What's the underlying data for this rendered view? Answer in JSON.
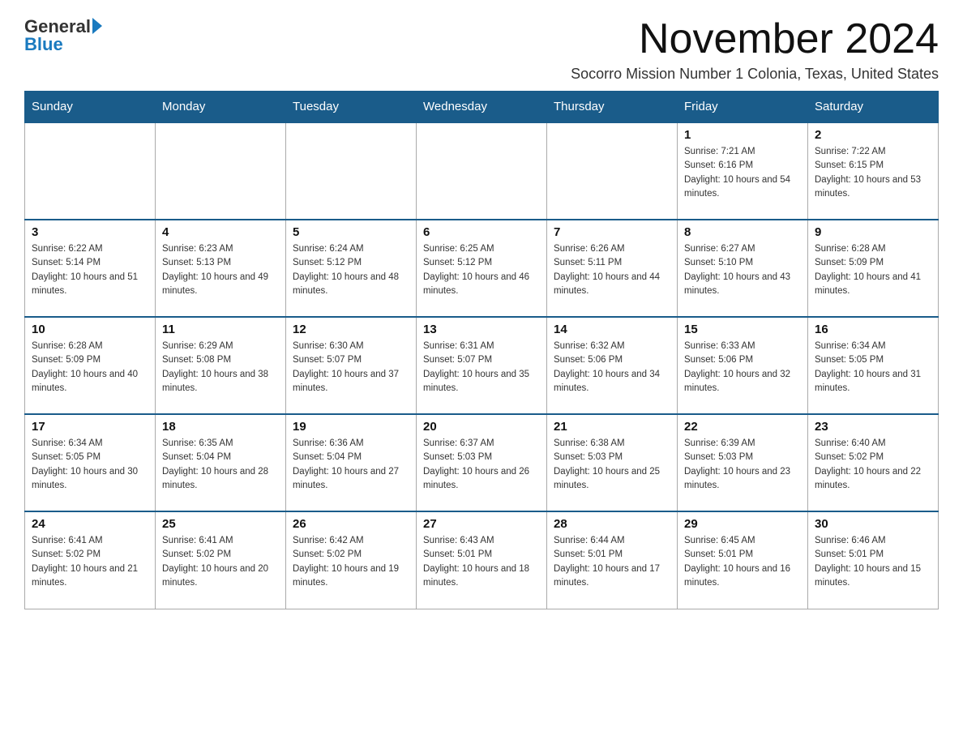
{
  "header": {
    "logo_general": "General",
    "logo_blue": "Blue",
    "month_title": "November 2024",
    "subtitle": "Socorro Mission Number 1 Colonia, Texas, United States"
  },
  "calendar": {
    "days_of_week": [
      "Sunday",
      "Monday",
      "Tuesday",
      "Wednesday",
      "Thursday",
      "Friday",
      "Saturday"
    ],
    "weeks": [
      [
        {
          "day": "",
          "info": ""
        },
        {
          "day": "",
          "info": ""
        },
        {
          "day": "",
          "info": ""
        },
        {
          "day": "",
          "info": ""
        },
        {
          "day": "",
          "info": ""
        },
        {
          "day": "1",
          "info": "Sunrise: 7:21 AM\nSunset: 6:16 PM\nDaylight: 10 hours and 54 minutes."
        },
        {
          "day": "2",
          "info": "Sunrise: 7:22 AM\nSunset: 6:15 PM\nDaylight: 10 hours and 53 minutes."
        }
      ],
      [
        {
          "day": "3",
          "info": "Sunrise: 6:22 AM\nSunset: 5:14 PM\nDaylight: 10 hours and 51 minutes."
        },
        {
          "day": "4",
          "info": "Sunrise: 6:23 AM\nSunset: 5:13 PM\nDaylight: 10 hours and 49 minutes."
        },
        {
          "day": "5",
          "info": "Sunrise: 6:24 AM\nSunset: 5:12 PM\nDaylight: 10 hours and 48 minutes."
        },
        {
          "day": "6",
          "info": "Sunrise: 6:25 AM\nSunset: 5:12 PM\nDaylight: 10 hours and 46 minutes."
        },
        {
          "day": "7",
          "info": "Sunrise: 6:26 AM\nSunset: 5:11 PM\nDaylight: 10 hours and 44 minutes."
        },
        {
          "day": "8",
          "info": "Sunrise: 6:27 AM\nSunset: 5:10 PM\nDaylight: 10 hours and 43 minutes."
        },
        {
          "day": "9",
          "info": "Sunrise: 6:28 AM\nSunset: 5:09 PM\nDaylight: 10 hours and 41 minutes."
        }
      ],
      [
        {
          "day": "10",
          "info": "Sunrise: 6:28 AM\nSunset: 5:09 PM\nDaylight: 10 hours and 40 minutes."
        },
        {
          "day": "11",
          "info": "Sunrise: 6:29 AM\nSunset: 5:08 PM\nDaylight: 10 hours and 38 minutes."
        },
        {
          "day": "12",
          "info": "Sunrise: 6:30 AM\nSunset: 5:07 PM\nDaylight: 10 hours and 37 minutes."
        },
        {
          "day": "13",
          "info": "Sunrise: 6:31 AM\nSunset: 5:07 PM\nDaylight: 10 hours and 35 minutes."
        },
        {
          "day": "14",
          "info": "Sunrise: 6:32 AM\nSunset: 5:06 PM\nDaylight: 10 hours and 34 minutes."
        },
        {
          "day": "15",
          "info": "Sunrise: 6:33 AM\nSunset: 5:06 PM\nDaylight: 10 hours and 32 minutes."
        },
        {
          "day": "16",
          "info": "Sunrise: 6:34 AM\nSunset: 5:05 PM\nDaylight: 10 hours and 31 minutes."
        }
      ],
      [
        {
          "day": "17",
          "info": "Sunrise: 6:34 AM\nSunset: 5:05 PM\nDaylight: 10 hours and 30 minutes."
        },
        {
          "day": "18",
          "info": "Sunrise: 6:35 AM\nSunset: 5:04 PM\nDaylight: 10 hours and 28 minutes."
        },
        {
          "day": "19",
          "info": "Sunrise: 6:36 AM\nSunset: 5:04 PM\nDaylight: 10 hours and 27 minutes."
        },
        {
          "day": "20",
          "info": "Sunrise: 6:37 AM\nSunset: 5:03 PM\nDaylight: 10 hours and 26 minutes."
        },
        {
          "day": "21",
          "info": "Sunrise: 6:38 AM\nSunset: 5:03 PM\nDaylight: 10 hours and 25 minutes."
        },
        {
          "day": "22",
          "info": "Sunrise: 6:39 AM\nSunset: 5:03 PM\nDaylight: 10 hours and 23 minutes."
        },
        {
          "day": "23",
          "info": "Sunrise: 6:40 AM\nSunset: 5:02 PM\nDaylight: 10 hours and 22 minutes."
        }
      ],
      [
        {
          "day": "24",
          "info": "Sunrise: 6:41 AM\nSunset: 5:02 PM\nDaylight: 10 hours and 21 minutes."
        },
        {
          "day": "25",
          "info": "Sunrise: 6:41 AM\nSunset: 5:02 PM\nDaylight: 10 hours and 20 minutes."
        },
        {
          "day": "26",
          "info": "Sunrise: 6:42 AM\nSunset: 5:02 PM\nDaylight: 10 hours and 19 minutes."
        },
        {
          "day": "27",
          "info": "Sunrise: 6:43 AM\nSunset: 5:01 PM\nDaylight: 10 hours and 18 minutes."
        },
        {
          "day": "28",
          "info": "Sunrise: 6:44 AM\nSunset: 5:01 PM\nDaylight: 10 hours and 17 minutes."
        },
        {
          "day": "29",
          "info": "Sunrise: 6:45 AM\nSunset: 5:01 PM\nDaylight: 10 hours and 16 minutes."
        },
        {
          "day": "30",
          "info": "Sunrise: 6:46 AM\nSunset: 5:01 PM\nDaylight: 10 hours and 15 minutes."
        }
      ]
    ]
  }
}
